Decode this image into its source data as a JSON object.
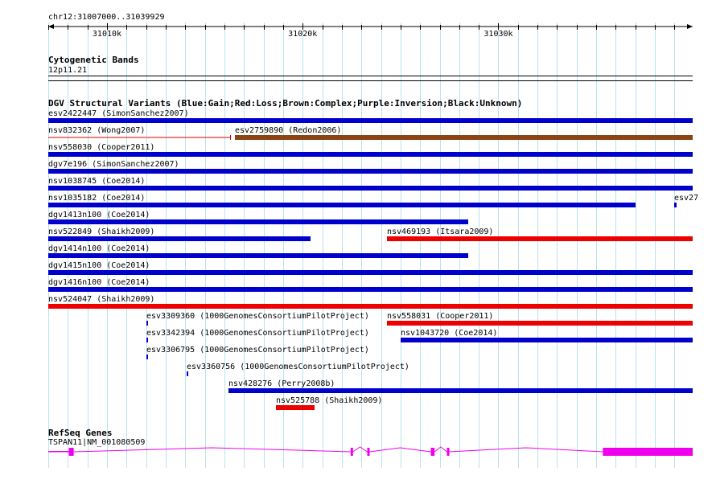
{
  "ruler": {
    "location": "chr12:31007000..31039929",
    "start": 31007000,
    "end": 31039929,
    "ticks": [
      {
        "pos": 31010000,
        "label": "31010k"
      },
      {
        "pos": 31020000,
        "label": "31020k"
      },
      {
        "pos": 31030000,
        "label": "31030k"
      }
    ]
  },
  "cytoband": {
    "title": "Cytogenetic Bands",
    "band": "12p11.21"
  },
  "dgv": {
    "title": "DGV Structural Variants (Blue:Gain;Red:Loss;Brown:Complex;Purple:Inversion;Black:Unknown)",
    "colors": {
      "gain": "#0000cc",
      "loss": "#ee0000",
      "complex": "#8b4513"
    },
    "features": [
      {
        "label": "esv2422447 (SimonSanchez2007)",
        "row": 0,
        "start": 31007000,
        "end": 31039929,
        "type": "gain"
      },
      {
        "label": "nsv832362 (Wong2007)",
        "row": 1,
        "start": 31007000,
        "end": 31016320,
        "type": "loss",
        "thin": true
      },
      {
        "label": "esv2759890 (Redon2006)",
        "row": 1,
        "start": 31016520,
        "end": 31039929,
        "type": "complex"
      },
      {
        "label": "nsv558030 (Cooper2011)",
        "row": 2,
        "start": 31007000,
        "end": 31039929,
        "type": "gain"
      },
      {
        "label": "dgv7e196 (SimonSanchez2007)",
        "row": 3,
        "start": 31007000,
        "end": 31039929,
        "type": "gain"
      },
      {
        "label": "nsv1038745 (Coe2014)",
        "row": 4,
        "start": 31007000,
        "end": 31039929,
        "type": "gain"
      },
      {
        "label": "nsv1035182 (Coe2014)",
        "row": 5,
        "start": 31007000,
        "end": 31036990,
        "type": "gain"
      },
      {
        "label": "esv27",
        "row": 5,
        "start": 31039000,
        "end": 31039100,
        "type": "gain"
      },
      {
        "label": "dgv1413n100 (Coe2014)",
        "row": 6,
        "start": 31007000,
        "end": 31028450,
        "type": "gain"
      },
      {
        "label": "nsv522849 (Shaikh2009)",
        "row": 7,
        "start": 31007000,
        "end": 31020420,
        "type": "gain"
      },
      {
        "label": "nsv469193 (Itsara2009)",
        "row": 7,
        "start": 31024300,
        "end": 31039929,
        "type": "loss"
      },
      {
        "label": "dgv1414n100 (Coe2014)",
        "row": 8,
        "start": 31007000,
        "end": 31028450,
        "type": "gain"
      },
      {
        "label": "dgv1415n100 (Coe2014)",
        "row": 9,
        "start": 31007000,
        "end": 31039929,
        "type": "gain"
      },
      {
        "label": "dgv1416n100 (Coe2014)",
        "row": 10,
        "start": 31007000,
        "end": 31039929,
        "type": "gain"
      },
      {
        "label": "nsv524047 (Shaikh2009)",
        "row": 11,
        "start": 31007000,
        "end": 31039929,
        "type": "loss"
      },
      {
        "label": "esv3309360 (1000GenomesConsortiumPilotProject)",
        "row": 12,
        "start": 31012000,
        "end": 31012090,
        "type": "gain"
      },
      {
        "label": "nsv558031 (Cooper2011)",
        "row": 12,
        "start": 31024300,
        "end": 31039929,
        "type": "loss"
      },
      {
        "label": "esv3342394 (1000GenomesConsortiumPilotProject)",
        "row": 13,
        "start": 31012000,
        "end": 31012090,
        "type": "gain"
      },
      {
        "label": "nsv1043720 (Coe2014)",
        "row": 13,
        "start": 31025000,
        "end": 31039929,
        "type": "gain"
      },
      {
        "label": "esv3306795 (1000GenomesConsortiumPilotProject)",
        "row": 14,
        "start": 31012000,
        "end": 31012090,
        "type": "gain"
      },
      {
        "label": "esv3360756 (1000GenomesConsortiumPilotProject)",
        "row": 15,
        "start": 31014060,
        "end": 31014150,
        "type": "gain"
      },
      {
        "label": "nsv428276 (Perry2008b)",
        "row": 16,
        "start": 31016200,
        "end": 31039929,
        "type": "gain"
      },
      {
        "label": "nsv525788 (Shaikh2009)",
        "row": 17,
        "start": 31018650,
        "end": 31020610,
        "type": "loss"
      }
    ]
  },
  "refseq": {
    "title": "RefSeq Genes",
    "gene_label": "TSPAN11|NM_001080509",
    "color": "#ee00ee",
    "start": 31007000,
    "end": 31039929,
    "exons": [
      [
        31008050,
        31008300
      ],
      [
        31022450,
        31022560
      ],
      [
        31023300,
        31023420
      ],
      [
        31026550,
        31026740
      ],
      [
        31027370,
        31027480
      ],
      [
        31035340,
        31039929
      ]
    ]
  }
}
